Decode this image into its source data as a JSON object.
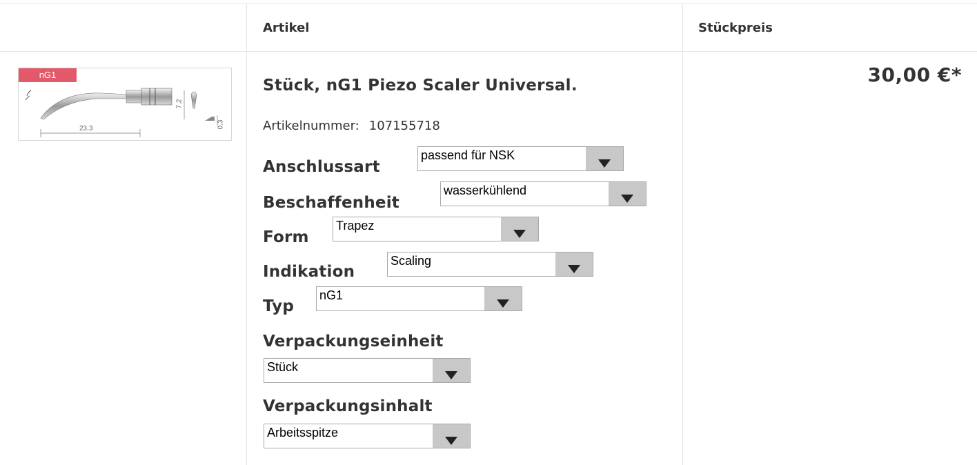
{
  "table": {
    "headers": {
      "article": "Artikel",
      "unit_price": "Stückpreis"
    }
  },
  "product": {
    "badge": "nG1",
    "title": "Stück, nG1 Piezo Scaler Universal.",
    "article_number_label": "Artikelnummer:",
    "article_number": "107155718",
    "price": "30,00 €*",
    "image_dimensions": {
      "width_label": "23.3",
      "height_label": "7.2",
      "tip_label": "0.3"
    },
    "options": [
      {
        "label": "Anschlussart",
        "value": "passend für NSK"
      },
      {
        "label": "Beschaffenheit",
        "value": "wasserkühlend"
      },
      {
        "label": "Form",
        "value": "Trapez"
      },
      {
        "label": "Indikation",
        "value": "Scaling"
      },
      {
        "label": "Typ",
        "value": "nG1"
      },
      {
        "label": "Verpackungseinheit",
        "value": "Stück"
      },
      {
        "label": "Verpackungsinhalt",
        "value": "Arbeitsspitze"
      }
    ]
  },
  "colors": {
    "badge": "#e25a6a",
    "select_button": "#c8c8c8",
    "grid_line": "#e4e4e4"
  },
  "icons": {
    "select_arrow": "triangle-down-icon"
  }
}
